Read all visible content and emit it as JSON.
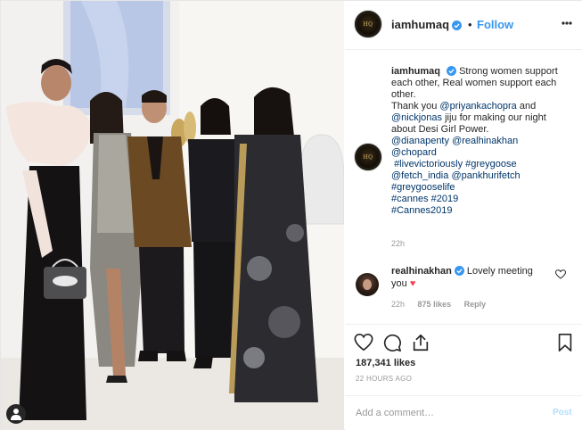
{
  "colors": {
    "link_blue": "#3897f0",
    "hashtag_navy": "#003569",
    "heart_red": "#ed4956",
    "muted_gray": "#999999",
    "post_disabled": "#b2dffc"
  },
  "photo": {
    "icon": "user-tag-icon"
  },
  "header": {
    "username": "iamhumaq",
    "separator": "•",
    "follow_label": "Follow",
    "avatar_monogram": "HQ",
    "more_icon": "more-options-icon"
  },
  "caption": {
    "username": "iamhumaq",
    "text1": "Strong women support each other, Real women support each other.",
    "thanks_prefix": "Thank you ",
    "mention_priyanka": "@priyankachopra",
    "and_text": " and",
    "mention_nick": "@nickjonas",
    "thanks_suffix": " jiju for making our night about Desi Girl Power.",
    "mention_diana": "@dianapenty",
    "mention_hina": "@realhinakhan",
    "mention_chopard": "@chopard",
    "tag_live": "#livevictoriously",
    "tag_grey": "#greygoose",
    "mention_fetch": "@fetch_india",
    "mention_pankhuri": "@pankhurifetch",
    "tag_greylife": "#greygooselife",
    "tag_cannes": "#cannes",
    "tag_2019": "#2019",
    "tag_cannes2019": "#Cannes2019",
    "time": "22h"
  },
  "reply": {
    "username": "realhinakhan",
    "text": "Lovely meeting you",
    "emoji": "♥",
    "time": "22h",
    "likes": "875 likes",
    "reply_label": "Reply"
  },
  "actions": {
    "like_icon": "heart-icon",
    "comment_icon": "comment-icon",
    "share_icon": "share-icon",
    "save_icon": "bookmark-icon"
  },
  "likes": "187,341 likes",
  "date": "22 HOURS AGO",
  "add_comment": {
    "placeholder": "Add a comment…",
    "post_label": "Post"
  }
}
